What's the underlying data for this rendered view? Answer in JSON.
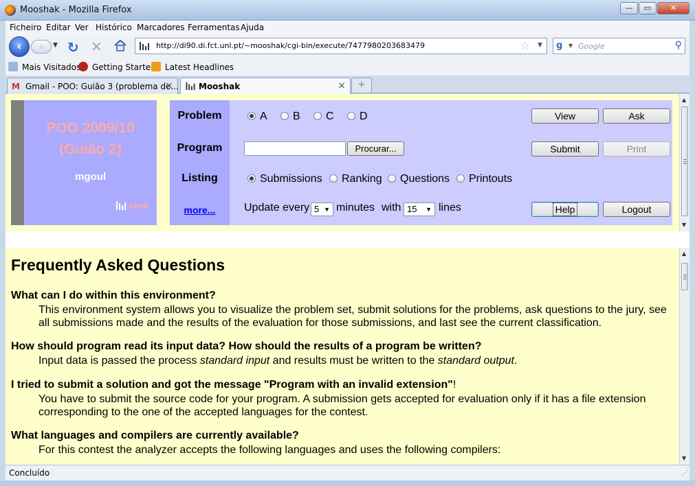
{
  "window": {
    "title": "Mooshak - Mozilla Firefox"
  },
  "menu": [
    "Ficheiro",
    "Editar",
    "Ver",
    "Histórico",
    "Marcadores",
    "Ferramentas",
    "Ajuda"
  ],
  "nav": {
    "url": "http://di90.di.fct.unl.pt/~mooshak/cgi-bin/execute/7477980203683479",
    "search_placeholder": "Google"
  },
  "bookmarks": [
    "Mais Visitados",
    "Getting Started",
    "Latest Headlines"
  ],
  "tabs": [
    {
      "label": "Gmail - POO: Guião 3 (problema de...",
      "active": false
    },
    {
      "label": "Mooshak",
      "active": true
    }
  ],
  "status": "Concluído",
  "logo": {
    "contest_line1": "POO 2009/10",
    "contest_line2": "(Guião 2)",
    "user": "mgoul",
    "brand": "shak"
  },
  "control": {
    "problem_label": "Problem",
    "program_label": "Program",
    "listing_label": "Listing",
    "more_link": "more...",
    "problems": [
      "A",
      "B",
      "C",
      "D"
    ],
    "selected_problem": "A",
    "browse_button": "Procurar...",
    "listings": [
      "Submissions",
      "Ranking",
      "Questions",
      "Printouts"
    ],
    "selected_listing": "Submissions",
    "update_prefix": "Update every",
    "update_minutes": "5",
    "minutes_word": "minutes",
    "with_word": "with",
    "lines_value": "15",
    "lines_word": "lines",
    "buttons": {
      "view": "View",
      "ask": "Ask",
      "submit": "Submit",
      "print": "Print",
      "help": "Help",
      "logout": "Logout"
    }
  },
  "faq": {
    "title": "Frequently Asked Questions",
    "items": [
      {
        "q": "What can I do within this environment?",
        "a": "This environment system allows you to visualize the problem set, submit solutions for the problems, ask questions to the jury, see all submissions made and the results of the evaluation for those submissions, and last see the current classification."
      },
      {
        "q": "How should program read its input data? How should the results of a program be written?",
        "a_pre": "Input data is passed the process ",
        "a_em1": "standard input",
        "a_mid": " and results must be written to the ",
        "a_em2": "standard output",
        "a_post": "."
      },
      {
        "q_pre": "I tried to submit a solution and got the message ",
        "q_quote": "\"Program with an invalid extension\"",
        "q_post": "!",
        "a": "You have to submit the source code for your program. A submission gets accepted for evaluation only if it has a file extension corresponding to the one of the accepted languages for the contest."
      },
      {
        "q": "What languages and compilers are currently available?",
        "a": "For this contest the analyzer accepts the following languages and uses the following compilers:"
      }
    ]
  }
}
